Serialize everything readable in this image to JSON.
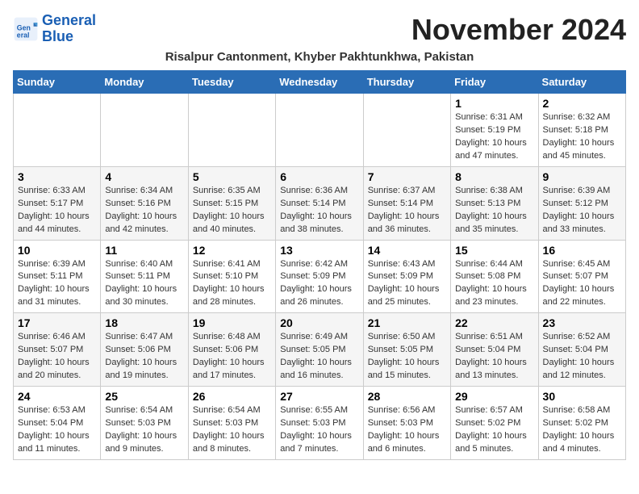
{
  "logo": {
    "line1": "General",
    "line2": "Blue"
  },
  "title": "November 2024",
  "subtitle": "Risalpur Cantonment, Khyber Pakhtunkhwa, Pakistan",
  "weekdays": [
    "Sunday",
    "Monday",
    "Tuesday",
    "Wednesday",
    "Thursday",
    "Friday",
    "Saturday"
  ],
  "weeks": [
    [
      {
        "day": "",
        "text": ""
      },
      {
        "day": "",
        "text": ""
      },
      {
        "day": "",
        "text": ""
      },
      {
        "day": "",
        "text": ""
      },
      {
        "day": "",
        "text": ""
      },
      {
        "day": "1",
        "text": "Sunrise: 6:31 AM\nSunset: 5:19 PM\nDaylight: 10 hours and 47 minutes."
      },
      {
        "day": "2",
        "text": "Sunrise: 6:32 AM\nSunset: 5:18 PM\nDaylight: 10 hours and 45 minutes."
      }
    ],
    [
      {
        "day": "3",
        "text": "Sunrise: 6:33 AM\nSunset: 5:17 PM\nDaylight: 10 hours and 44 minutes."
      },
      {
        "day": "4",
        "text": "Sunrise: 6:34 AM\nSunset: 5:16 PM\nDaylight: 10 hours and 42 minutes."
      },
      {
        "day": "5",
        "text": "Sunrise: 6:35 AM\nSunset: 5:15 PM\nDaylight: 10 hours and 40 minutes."
      },
      {
        "day": "6",
        "text": "Sunrise: 6:36 AM\nSunset: 5:14 PM\nDaylight: 10 hours and 38 minutes."
      },
      {
        "day": "7",
        "text": "Sunrise: 6:37 AM\nSunset: 5:14 PM\nDaylight: 10 hours and 36 minutes."
      },
      {
        "day": "8",
        "text": "Sunrise: 6:38 AM\nSunset: 5:13 PM\nDaylight: 10 hours and 35 minutes."
      },
      {
        "day": "9",
        "text": "Sunrise: 6:39 AM\nSunset: 5:12 PM\nDaylight: 10 hours and 33 minutes."
      }
    ],
    [
      {
        "day": "10",
        "text": "Sunrise: 6:39 AM\nSunset: 5:11 PM\nDaylight: 10 hours and 31 minutes."
      },
      {
        "day": "11",
        "text": "Sunrise: 6:40 AM\nSunset: 5:11 PM\nDaylight: 10 hours and 30 minutes."
      },
      {
        "day": "12",
        "text": "Sunrise: 6:41 AM\nSunset: 5:10 PM\nDaylight: 10 hours and 28 minutes."
      },
      {
        "day": "13",
        "text": "Sunrise: 6:42 AM\nSunset: 5:09 PM\nDaylight: 10 hours and 26 minutes."
      },
      {
        "day": "14",
        "text": "Sunrise: 6:43 AM\nSunset: 5:09 PM\nDaylight: 10 hours and 25 minutes."
      },
      {
        "day": "15",
        "text": "Sunrise: 6:44 AM\nSunset: 5:08 PM\nDaylight: 10 hours and 23 minutes."
      },
      {
        "day": "16",
        "text": "Sunrise: 6:45 AM\nSunset: 5:07 PM\nDaylight: 10 hours and 22 minutes."
      }
    ],
    [
      {
        "day": "17",
        "text": "Sunrise: 6:46 AM\nSunset: 5:07 PM\nDaylight: 10 hours and 20 minutes."
      },
      {
        "day": "18",
        "text": "Sunrise: 6:47 AM\nSunset: 5:06 PM\nDaylight: 10 hours and 19 minutes."
      },
      {
        "day": "19",
        "text": "Sunrise: 6:48 AM\nSunset: 5:06 PM\nDaylight: 10 hours and 17 minutes."
      },
      {
        "day": "20",
        "text": "Sunrise: 6:49 AM\nSunset: 5:05 PM\nDaylight: 10 hours and 16 minutes."
      },
      {
        "day": "21",
        "text": "Sunrise: 6:50 AM\nSunset: 5:05 PM\nDaylight: 10 hours and 15 minutes."
      },
      {
        "day": "22",
        "text": "Sunrise: 6:51 AM\nSunset: 5:04 PM\nDaylight: 10 hours and 13 minutes."
      },
      {
        "day": "23",
        "text": "Sunrise: 6:52 AM\nSunset: 5:04 PM\nDaylight: 10 hours and 12 minutes."
      }
    ],
    [
      {
        "day": "24",
        "text": "Sunrise: 6:53 AM\nSunset: 5:04 PM\nDaylight: 10 hours and 11 minutes."
      },
      {
        "day": "25",
        "text": "Sunrise: 6:54 AM\nSunset: 5:03 PM\nDaylight: 10 hours and 9 minutes."
      },
      {
        "day": "26",
        "text": "Sunrise: 6:54 AM\nSunset: 5:03 PM\nDaylight: 10 hours and 8 minutes."
      },
      {
        "day": "27",
        "text": "Sunrise: 6:55 AM\nSunset: 5:03 PM\nDaylight: 10 hours and 7 minutes."
      },
      {
        "day": "28",
        "text": "Sunrise: 6:56 AM\nSunset: 5:03 PM\nDaylight: 10 hours and 6 minutes."
      },
      {
        "day": "29",
        "text": "Sunrise: 6:57 AM\nSunset: 5:02 PM\nDaylight: 10 hours and 5 minutes."
      },
      {
        "day": "30",
        "text": "Sunrise: 6:58 AM\nSunset: 5:02 PM\nDaylight: 10 hours and 4 minutes."
      }
    ]
  ]
}
